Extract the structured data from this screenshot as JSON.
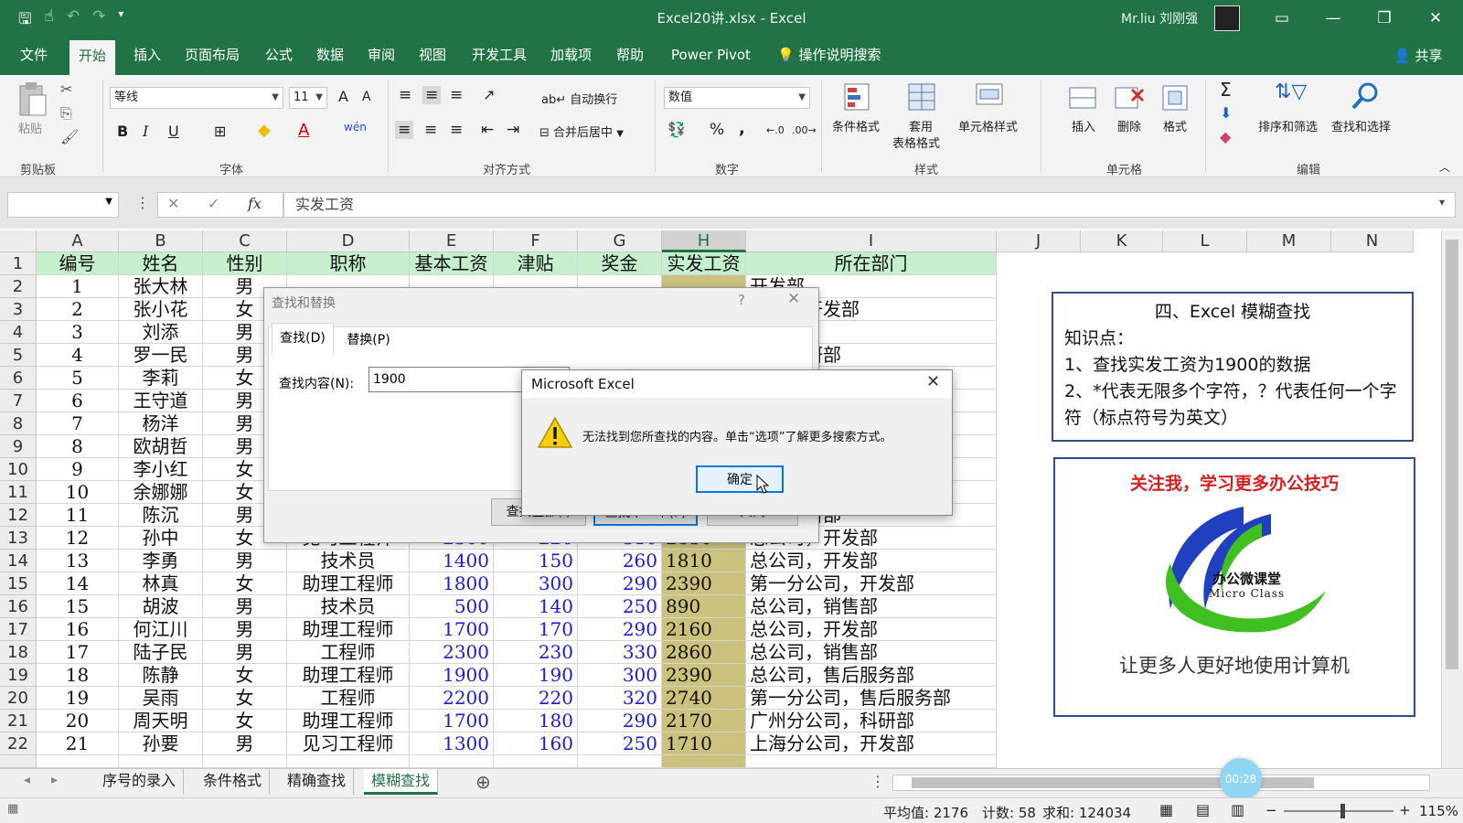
{
  "window": {
    "title": "Excel20讲.xlsx  -  Excel",
    "user": "Mr.liu 刘刚强"
  },
  "menu": {
    "tabs": [
      "文件",
      "开始",
      "插入",
      "页面布局",
      "公式",
      "数据",
      "审阅",
      "视图",
      "开发工具",
      "加载项",
      "帮助",
      "Power Pivot"
    ],
    "search": "操作说明搜索",
    "share": "共享"
  },
  "ribbon": {
    "clipboard": {
      "paste": "粘贴",
      "label": "剪贴板"
    },
    "font": {
      "name": "等线",
      "size": "11",
      "label": "字体",
      "bold": "B",
      "italic": "I",
      "underline": "U",
      "grow": "A",
      "shrink": "A",
      "color_a": "A",
      "wen": "wén"
    },
    "align": {
      "wrap": "自动换行",
      "merge": "合并后居中",
      "label": "对齐方式"
    },
    "number": {
      "format": "数值",
      "percent": "%",
      "comma": ",",
      "label": "数字"
    },
    "styles": {
      "cond": "条件格式",
      "table1": "套用",
      "table2": "表格格式",
      "cell": "单元格样式",
      "label": "样式"
    },
    "cells": {
      "insert": "插入",
      "delete": "删除",
      "format": "格式",
      "label": "单元格"
    },
    "editing": {
      "sigma": "Σ",
      "sort": "排序和筛选",
      "find": "查找和选择",
      "label": "编辑"
    }
  },
  "formula": {
    "fx": "fx",
    "content": "实发工资"
  },
  "columns": [
    "A",
    "B",
    "C",
    "D",
    "E",
    "F",
    "G",
    "H",
    "I",
    "J",
    "K",
    "L",
    "M",
    "N"
  ],
  "headers": [
    "编号",
    "姓名",
    "性别",
    "职称",
    "基本工资",
    "津贴",
    "奖金",
    "实发工资",
    "所在部门"
  ],
  "rows": [
    {
      "n": "2",
      "id": "1",
      "name": "张大林",
      "sex": "男",
      "title": "",
      "base": "",
      "allow": "",
      "bonus": "",
      "total": "",
      "dept": "开发部"
    },
    {
      "n": "3",
      "id": "2",
      "name": "张小花",
      "sex": "女",
      "title": "",
      "base": "",
      "allow": "",
      "bonus": "",
      "total": "",
      "dept": "公司，开发部"
    },
    {
      "n": "4",
      "id": "3",
      "name": "刘添",
      "sex": "男",
      "title": "",
      "base": "",
      "allow": "",
      "bonus": "",
      "total": "",
      "dept": "开发部"
    },
    {
      "n": "5",
      "id": "4",
      "name": "罗一民",
      "sex": "男",
      "title": "",
      "base": "",
      "allow": "",
      "bonus": "",
      "total": "",
      "dept": "司，科研部"
    },
    {
      "n": "6",
      "id": "5",
      "name": "李莉",
      "sex": "女",
      "title": "",
      "base": "",
      "allow": "",
      "bonus": "",
      "total": "",
      "dept": ""
    },
    {
      "n": "7",
      "id": "6",
      "name": "王守道",
      "sex": "男",
      "title": "",
      "base": "",
      "allow": "",
      "bonus": "",
      "total": "",
      "dept": ""
    },
    {
      "n": "8",
      "id": "7",
      "name": "杨洋",
      "sex": "男",
      "title": "",
      "base": "",
      "allow": "",
      "bonus": "",
      "total": "",
      "dept": ""
    },
    {
      "n": "9",
      "id": "8",
      "name": "欧胡哲",
      "sex": "男",
      "title": "",
      "base": "",
      "allow": "",
      "bonus": "",
      "total": "",
      "dept": ""
    },
    {
      "n": "10",
      "id": "9",
      "name": "李小红",
      "sex": "女",
      "title": "",
      "base": "",
      "allow": "",
      "bonus": "",
      "total": "",
      "dept": ""
    },
    {
      "n": "11",
      "id": "10",
      "name": "余娜娜",
      "sex": "女",
      "title": "",
      "base": "",
      "allow": "",
      "bonus": "",
      "total": "",
      "dept": ""
    },
    {
      "n": "12",
      "id": "11",
      "name": "陈沉",
      "sex": "男",
      "title": "",
      "base": "",
      "allow": "",
      "bonus": "",
      "total": "",
      "dept": "司，科研部"
    },
    {
      "n": "13",
      "id": "12",
      "name": "孙中",
      "sex": "女",
      "title": "见习工程师",
      "base": "2300",
      "allow": "220",
      "bonus": "310",
      "total": "2830",
      "dept": "总公司，开发部"
    },
    {
      "n": "14",
      "id": "13",
      "name": "李勇",
      "sex": "男",
      "title": "技术员",
      "base": "1400",
      "allow": "150",
      "bonus": "260",
      "total": "1810",
      "dept": "总公司，开发部"
    },
    {
      "n": "15",
      "id": "14",
      "name": "林真",
      "sex": "女",
      "title": "助理工程师",
      "base": "1800",
      "allow": "300",
      "bonus": "290",
      "total": "2390",
      "dept": "第一分公司，开发部"
    },
    {
      "n": "16",
      "id": "15",
      "name": "胡波",
      "sex": "男",
      "title": "技术员",
      "base": "500",
      "allow": "140",
      "bonus": "250",
      "total": "890",
      "dept": "总公司，销售部"
    },
    {
      "n": "17",
      "id": "16",
      "name": "何江川",
      "sex": "男",
      "title": "助理工程师",
      "base": "1700",
      "allow": "170",
      "bonus": "290",
      "total": "2160",
      "dept": "总公司，开发部"
    },
    {
      "n": "18",
      "id": "17",
      "name": "陆子民",
      "sex": "男",
      "title": "工程师",
      "base": "2300",
      "allow": "230",
      "bonus": "330",
      "total": "2860",
      "dept": "总公司，销售部"
    },
    {
      "n": "19",
      "id": "18",
      "name": "陈静",
      "sex": "女",
      "title": "助理工程师",
      "base": "1900",
      "allow": "190",
      "bonus": "300",
      "total": "2390",
      "dept": "总公司，售后服务部"
    },
    {
      "n": "20",
      "id": "19",
      "name": "吴雨",
      "sex": "女",
      "title": "工程师",
      "base": "2200",
      "allow": "220",
      "bonus": "320",
      "total": "2740",
      "dept": "第一分公司，售后服务部"
    },
    {
      "n": "21",
      "id": "20",
      "name": "周天明",
      "sex": "女",
      "title": "助理工程师",
      "base": "1700",
      "allow": "180",
      "bonus": "290",
      "total": "2170",
      "dept": "广州分公司，科研部"
    },
    {
      "n": "22",
      "id": "21",
      "name": "孙要",
      "sex": "男",
      "title": "见习工程师",
      "base": "1300",
      "allow": "160",
      "bonus": "250",
      "total": "1710",
      "dept": "上海分公司，开发部"
    }
  ],
  "info": {
    "title": "四、Excel 模糊查找",
    "line1": "知识点：",
    "line2": "1、查找实发工资为1900的数据",
    "line3": "2、*代表无限多个字符，？代表任何一个字符（标点符号为英文）",
    "follow": "关注我，学习更多办公技巧",
    "logo_cn": "办公微课堂",
    "logo_en": "Micro Class",
    "slogan": "让更多人更好地使用计算机"
  },
  "find_dialog": {
    "title": "查找和替换",
    "help": "?",
    "tab_find": "查找(D)",
    "tab_replace": "替换(P)",
    "label": "查找内容(N):",
    "value": "1900",
    "find_all": "查找全部(I)",
    "find_next": "查找下一个(F)",
    "close": "关闭"
  },
  "msgbox": {
    "title": "Microsoft Excel",
    "message": "无法找到您所查找的内容。单击“选项”了解更多搜索方式。",
    "ok": "确定"
  },
  "sheets": [
    "序号的录入",
    "条件格式",
    "精确查找",
    "模糊查找"
  ],
  "status": {
    "avg": "平均值: 2176",
    "count": "计数: 58",
    "sum": "求和: 124034",
    "zoom": "115%",
    "timer": "00:28"
  },
  "colors": {
    "excel_green": "#217346",
    "header_fill": "#c6efce",
    "highlight_col": "#cbc27e",
    "number_blue": "#1a1ad8",
    "info_border": "#2e4d8a"
  }
}
